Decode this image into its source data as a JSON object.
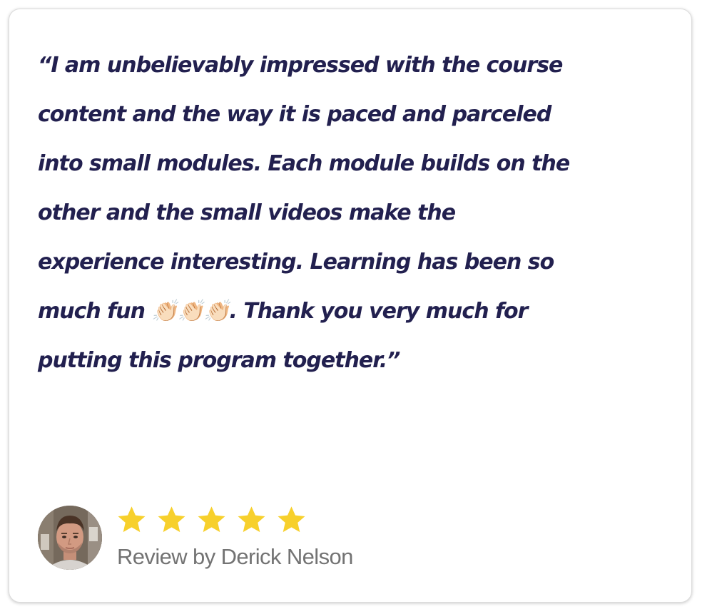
{
  "testimonial": {
    "quote": "“I am unbelievably impressed with the course\ncontent and the way it is paced and parceled\ninto small modules. Each module builds on the\nother and the small videos make the\nexperience interesting. Learning has been so\nmuch fun 👏🏻👏🏻👏🏻. Thank you very much for\nputting this program together.”"
  },
  "reviewer": {
    "label": "Review by Derick Nelson",
    "rating": 5,
    "rating_max": 5,
    "avatar_icon": "reviewer-avatar-photo"
  },
  "colors": {
    "quote_text": "#22204f",
    "star": "#f7d02c",
    "review_label": "#737373",
    "card_border": "#dcdcdc"
  }
}
